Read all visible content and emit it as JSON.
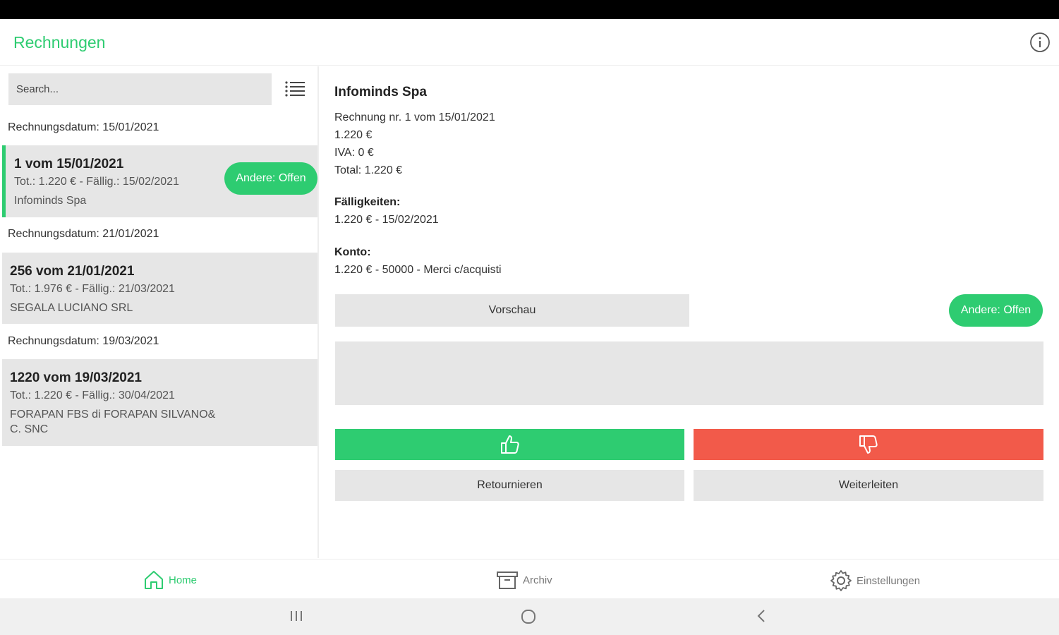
{
  "app": {
    "title": "Rechnungen"
  },
  "search": {
    "placeholder": "Search..."
  },
  "groups": [
    {
      "label": "Rechnungsdatum: 15/01/2021",
      "invoice": {
        "title": "1 vom 15/01/2021",
        "summary": "Tot.: 1.220 € - Fällig.: 15/02/2021",
        "supplier": "Infominds Spa",
        "status": "Andere: Offen",
        "selected": true
      }
    },
    {
      "label": "Rechnungsdatum: 21/01/2021",
      "invoice": {
        "title": "256 vom 21/01/2021",
        "summary": "Tot.: 1.976 € - Fällig.: 21/03/2021",
        "supplier": "SEGALA LUCIANO SRL",
        "selected": false
      }
    },
    {
      "label": "Rechnungsdatum: 19/03/2021",
      "invoice": {
        "title": "1220 vom 19/03/2021",
        "summary": "Tot.: 1.220 € - Fällig.: 30/04/2021",
        "supplier": "FORAPAN FBS di FORAPAN SILVANO& C. SNC",
        "selected": false
      }
    }
  ],
  "detail": {
    "company": "Infominds Spa",
    "invoice_line": "Rechnung nr. 1 vom 15/01/2021",
    "amount": "1.220 €",
    "iva": "IVA: 0 €",
    "total": "Total: 1.220 €",
    "due_label": "Fälligkeiten:",
    "due_value": "1.220 € - 15/02/2021",
    "account_label": "Konto:",
    "account_value": "1.220 € - 50000 - Merci c/acquisti",
    "preview_label": "Vorschau",
    "status": "Andere: Offen",
    "return_label": "Retournieren",
    "forward_label": "Weiterleiten"
  },
  "nav": {
    "home": "Home",
    "archive": "Archiv",
    "settings": "Einstellungen"
  },
  "colors": {
    "accent": "#2ecc71",
    "reject": "#f25a4a",
    "surface": "#e6e6e6"
  }
}
